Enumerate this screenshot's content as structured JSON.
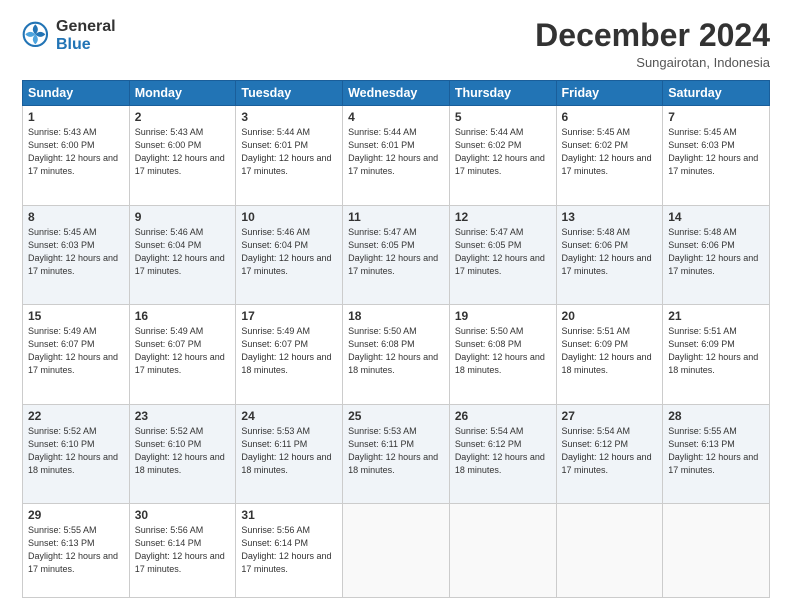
{
  "logo": {
    "general": "General",
    "blue": "Blue"
  },
  "header": {
    "month": "December 2024",
    "location": "Sungairotan, Indonesia"
  },
  "days_of_week": [
    "Sunday",
    "Monday",
    "Tuesday",
    "Wednesday",
    "Thursday",
    "Friday",
    "Saturday"
  ],
  "weeks": [
    [
      {
        "day": "1",
        "sunrise": "5:43 AM",
        "sunset": "6:00 PM",
        "daylight": "12 hours and 17 minutes"
      },
      {
        "day": "2",
        "sunrise": "5:43 AM",
        "sunset": "6:00 PM",
        "daylight": "12 hours and 17 minutes"
      },
      {
        "day": "3",
        "sunrise": "5:44 AM",
        "sunset": "6:01 PM",
        "daylight": "12 hours and 17 minutes"
      },
      {
        "day": "4",
        "sunrise": "5:44 AM",
        "sunset": "6:01 PM",
        "daylight": "12 hours and 17 minutes"
      },
      {
        "day": "5",
        "sunrise": "5:44 AM",
        "sunset": "6:02 PM",
        "daylight": "12 hours and 17 minutes"
      },
      {
        "day": "6",
        "sunrise": "5:45 AM",
        "sunset": "6:02 PM",
        "daylight": "12 hours and 17 minutes"
      },
      {
        "day": "7",
        "sunrise": "5:45 AM",
        "sunset": "6:03 PM",
        "daylight": "12 hours and 17 minutes"
      }
    ],
    [
      {
        "day": "8",
        "sunrise": "5:45 AM",
        "sunset": "6:03 PM",
        "daylight": "12 hours and 17 minutes"
      },
      {
        "day": "9",
        "sunrise": "5:46 AM",
        "sunset": "6:04 PM",
        "daylight": "12 hours and 17 minutes"
      },
      {
        "day": "10",
        "sunrise": "5:46 AM",
        "sunset": "6:04 PM",
        "daylight": "12 hours and 17 minutes"
      },
      {
        "day": "11",
        "sunrise": "5:47 AM",
        "sunset": "6:05 PM",
        "daylight": "12 hours and 17 minutes"
      },
      {
        "day": "12",
        "sunrise": "5:47 AM",
        "sunset": "6:05 PM",
        "daylight": "12 hours and 17 minutes"
      },
      {
        "day": "13",
        "sunrise": "5:48 AM",
        "sunset": "6:06 PM",
        "daylight": "12 hours and 17 minutes"
      },
      {
        "day": "14",
        "sunrise": "5:48 AM",
        "sunset": "6:06 PM",
        "daylight": "12 hours and 17 minutes"
      }
    ],
    [
      {
        "day": "15",
        "sunrise": "5:49 AM",
        "sunset": "6:07 PM",
        "daylight": "12 hours and 17 minutes"
      },
      {
        "day": "16",
        "sunrise": "5:49 AM",
        "sunset": "6:07 PM",
        "daylight": "12 hours and 17 minutes"
      },
      {
        "day": "17",
        "sunrise": "5:49 AM",
        "sunset": "6:07 PM",
        "daylight": "12 hours and 18 minutes"
      },
      {
        "day": "18",
        "sunrise": "5:50 AM",
        "sunset": "6:08 PM",
        "daylight": "12 hours and 18 minutes"
      },
      {
        "day": "19",
        "sunrise": "5:50 AM",
        "sunset": "6:08 PM",
        "daylight": "12 hours and 18 minutes"
      },
      {
        "day": "20",
        "sunrise": "5:51 AM",
        "sunset": "6:09 PM",
        "daylight": "12 hours and 18 minutes"
      },
      {
        "day": "21",
        "sunrise": "5:51 AM",
        "sunset": "6:09 PM",
        "daylight": "12 hours and 18 minutes"
      }
    ],
    [
      {
        "day": "22",
        "sunrise": "5:52 AM",
        "sunset": "6:10 PM",
        "daylight": "12 hours and 18 minutes"
      },
      {
        "day": "23",
        "sunrise": "5:52 AM",
        "sunset": "6:10 PM",
        "daylight": "12 hours and 18 minutes"
      },
      {
        "day": "24",
        "sunrise": "5:53 AM",
        "sunset": "6:11 PM",
        "daylight": "12 hours and 18 minutes"
      },
      {
        "day": "25",
        "sunrise": "5:53 AM",
        "sunset": "6:11 PM",
        "daylight": "12 hours and 18 minutes"
      },
      {
        "day": "26",
        "sunrise": "5:54 AM",
        "sunset": "6:12 PM",
        "daylight": "12 hours and 18 minutes"
      },
      {
        "day": "27",
        "sunrise": "5:54 AM",
        "sunset": "6:12 PM",
        "daylight": "12 hours and 17 minutes"
      },
      {
        "day": "28",
        "sunrise": "5:55 AM",
        "sunset": "6:13 PM",
        "daylight": "12 hours and 17 minutes"
      }
    ],
    [
      {
        "day": "29",
        "sunrise": "5:55 AM",
        "sunset": "6:13 PM",
        "daylight": "12 hours and 17 minutes"
      },
      {
        "day": "30",
        "sunrise": "5:56 AM",
        "sunset": "6:14 PM",
        "daylight": "12 hours and 17 minutes"
      },
      {
        "day": "31",
        "sunrise": "5:56 AM",
        "sunset": "6:14 PM",
        "daylight": "12 hours and 17 minutes"
      },
      null,
      null,
      null,
      null
    ]
  ]
}
